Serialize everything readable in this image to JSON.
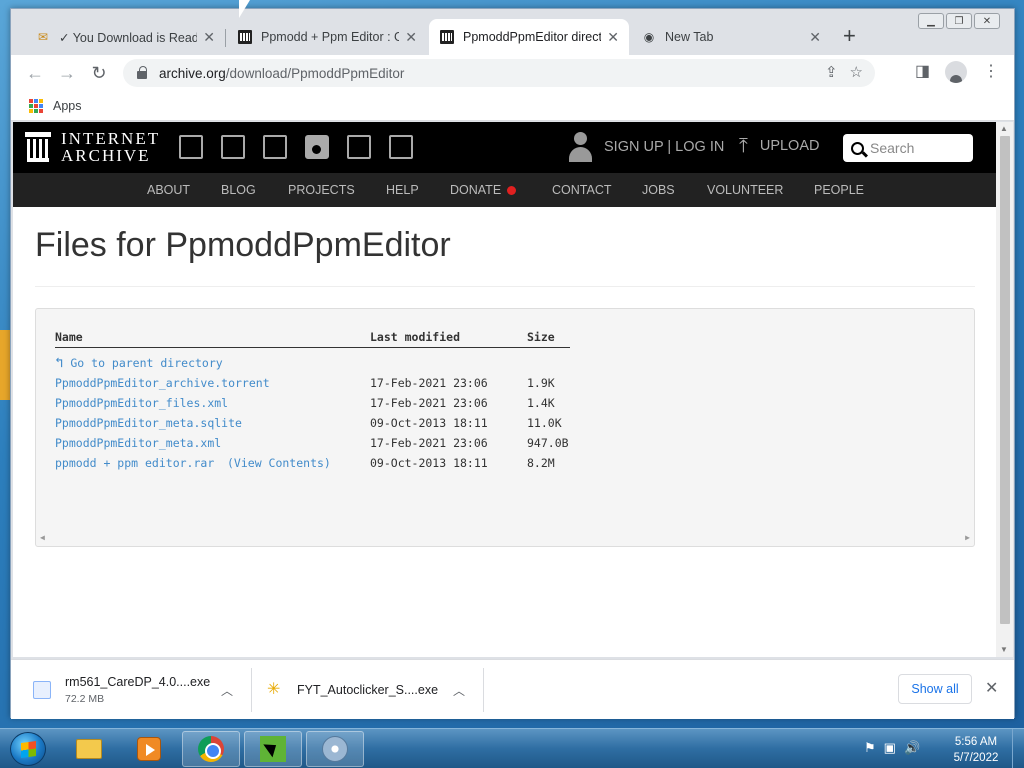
{
  "browser": {
    "tabs": [
      {
        "title": "✓ You Download is Ready",
        "active": false,
        "favicon": "download-folder-icon"
      },
      {
        "title": "Ppmodd + Ppm Editor : G",
        "active": false,
        "favicon": "internet-archive-icon"
      },
      {
        "title": "PpmoddPpmEditor direct",
        "active": true,
        "favicon": "internet-archive-icon"
      },
      {
        "title": "New Tab",
        "active": false,
        "favicon": "chrome-icon"
      }
    ],
    "url_host": "archive.org",
    "url_path": "/download/PpmoddPpmEditor",
    "bookmarks": [
      {
        "label": "Apps"
      }
    ]
  },
  "ia": {
    "logo_line1": "INTERNET",
    "logo_line2": "ARCHIVE",
    "signin": "SIGN UP | LOG IN",
    "upload": "UPLOAD",
    "search_placeholder": "Search",
    "nav": [
      "ABOUT",
      "BLOG",
      "PROJECTS",
      "HELP",
      "DONATE",
      "CONTACT",
      "JOBS",
      "VOLUNTEER",
      "PEOPLE"
    ]
  },
  "page": {
    "title": "Files for PpmoddPpmEditor",
    "columns": {
      "name": "Name",
      "modified": "Last modified",
      "size": "Size"
    },
    "parent_link": "Go to parent directory",
    "files": [
      {
        "name": "PpmoddPpmEditor_archive.torrent",
        "modified": "17-Feb-2021 23:06",
        "size": "1.9K"
      },
      {
        "name": "PpmoddPpmEditor_files.xml",
        "modified": "17-Feb-2021 23:06",
        "size": "1.4K"
      },
      {
        "name": "PpmoddPpmEditor_meta.sqlite",
        "modified": "09-Oct-2013 18:11",
        "size": "11.0K"
      },
      {
        "name": "PpmoddPpmEditor_meta.xml",
        "modified": "17-Feb-2021 23:06",
        "size": "947.0B"
      },
      {
        "name": "ppmodd + ppm editor.rar",
        "modified": "09-Oct-2013 18:11",
        "size": "8.2M"
      }
    ],
    "view_contents": "(View Contents)"
  },
  "downloads": {
    "items": [
      {
        "name": "rm561_CareDP_4.0....exe",
        "size": "72.2 MB"
      },
      {
        "name": "FYT_Autoclicker_S....exe",
        "size": ""
      }
    ],
    "show_all": "Show all"
  },
  "taskbar": {
    "time": "5:56 AM",
    "date": "5/7/2022"
  },
  "colors": {
    "link": "#428bca",
    "ia_header": "#000000",
    "ia_nav": "#222222",
    "donate_dot": "#e02020",
    "chrome_accent": "#1a73e8"
  }
}
